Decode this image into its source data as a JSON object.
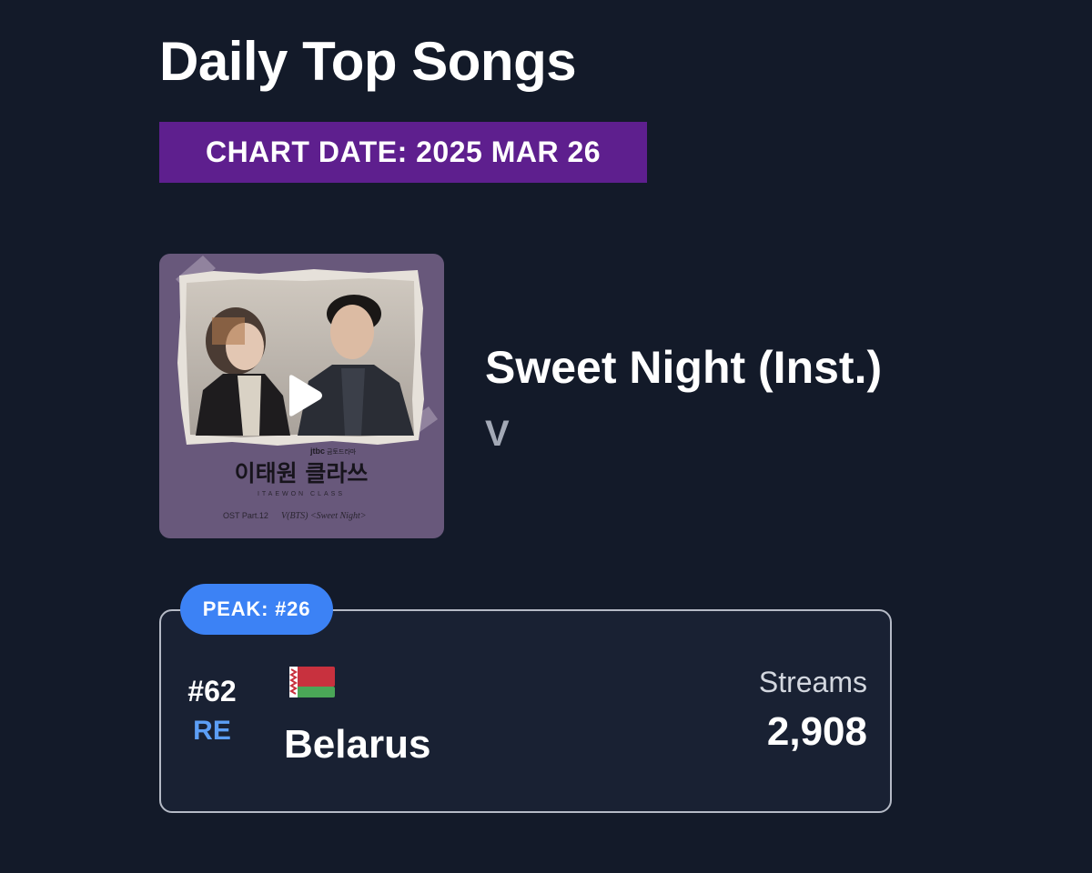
{
  "header": {
    "title": "Daily Top Songs",
    "chart_date": "CHART DATE: 2025 MAR 26"
  },
  "song": {
    "title": "Sweet Night (Inst.)",
    "artist": "V",
    "cover": {
      "network_logo": "jtbc",
      "drama_label": "금토드라마",
      "drama_title": "이태원 클라쓰",
      "drama_subtitle": "ITAEWON CLASS",
      "ost_part": "OST Part.12",
      "ost_credit": "V(BTS) <Sweet Night>"
    },
    "play_icon": "play-icon"
  },
  "stats": {
    "peak": "PEAK: #26",
    "rank": "#62",
    "status": "RE",
    "country": "Belarus",
    "flag_icon": "belarus-flag-icon",
    "streams_label": "Streams",
    "streams": "2,908"
  },
  "colors": {
    "background": "#131a29",
    "chart_date_bg": "#5e1f8e",
    "peak_badge_bg": "#3c82f5",
    "status_re": "#5c9ef5",
    "artist": "#a3a9b6"
  }
}
